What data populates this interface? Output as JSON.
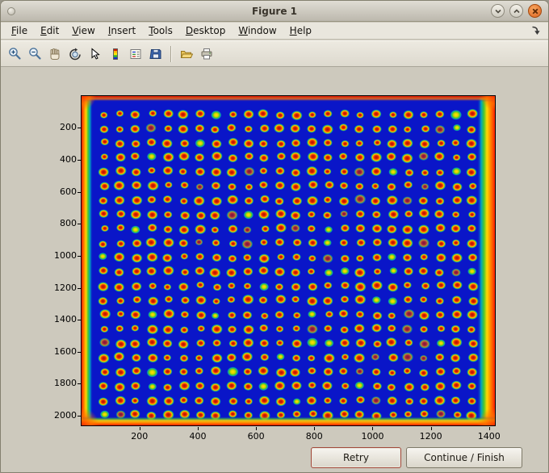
{
  "window": {
    "title": "Figure 1"
  },
  "titlebar": {
    "controls": [
      "minimize",
      "maximize",
      "close"
    ]
  },
  "menubar": {
    "items": [
      "File",
      "Edit",
      "View",
      "Insert",
      "Tools",
      "Desktop",
      "Window",
      "Help"
    ]
  },
  "toolbar": {
    "icons": [
      "zoom-in",
      "zoom-out",
      "pan",
      "rotate-3d",
      "data-cursor",
      "insert-colorbar",
      "insert-legend",
      "save",
      "open",
      "print"
    ]
  },
  "buttons": {
    "retry": "Retry",
    "continue_finish": "Continue / Finish"
  },
  "chart_data": {
    "type": "heatmap",
    "title": "",
    "description": "Microarray plate scan rendered with jet colormap: deep blue field with a 24x22 grid of red/orange spots ringed in yellow-green, and saturated red/orange/yellow bands along all four image edges",
    "colormap": "jet",
    "x_ticks": [
      200,
      400,
      600,
      800,
      1000,
      1200,
      1400
    ],
    "y_ticks": [
      200,
      400,
      600,
      800,
      1000,
      1200,
      1400,
      1600,
      1800,
      2000
    ],
    "x_range": [
      1,
      1420
    ],
    "y_range": [
      1,
      2060
    ],
    "grid": {
      "cols": 24,
      "rows": 22,
      "x_start": 78,
      "x_spacing": 55,
      "y_start": 115,
      "y_spacing": 89.5
    },
    "colors": {
      "background": "#0a16c8",
      "spot_core": "#d21e00",
      "spot_mid": "#ff5c00",
      "spot_ring": "#ffc800",
      "spot_halo": "#6ec41e",
      "cyan": "#00a8c0",
      "edge_red": "#ff2000",
      "edge_orange": "#ff7a00",
      "edge_yellow": "#ffd800",
      "edge_green": "#46c832"
    }
  }
}
